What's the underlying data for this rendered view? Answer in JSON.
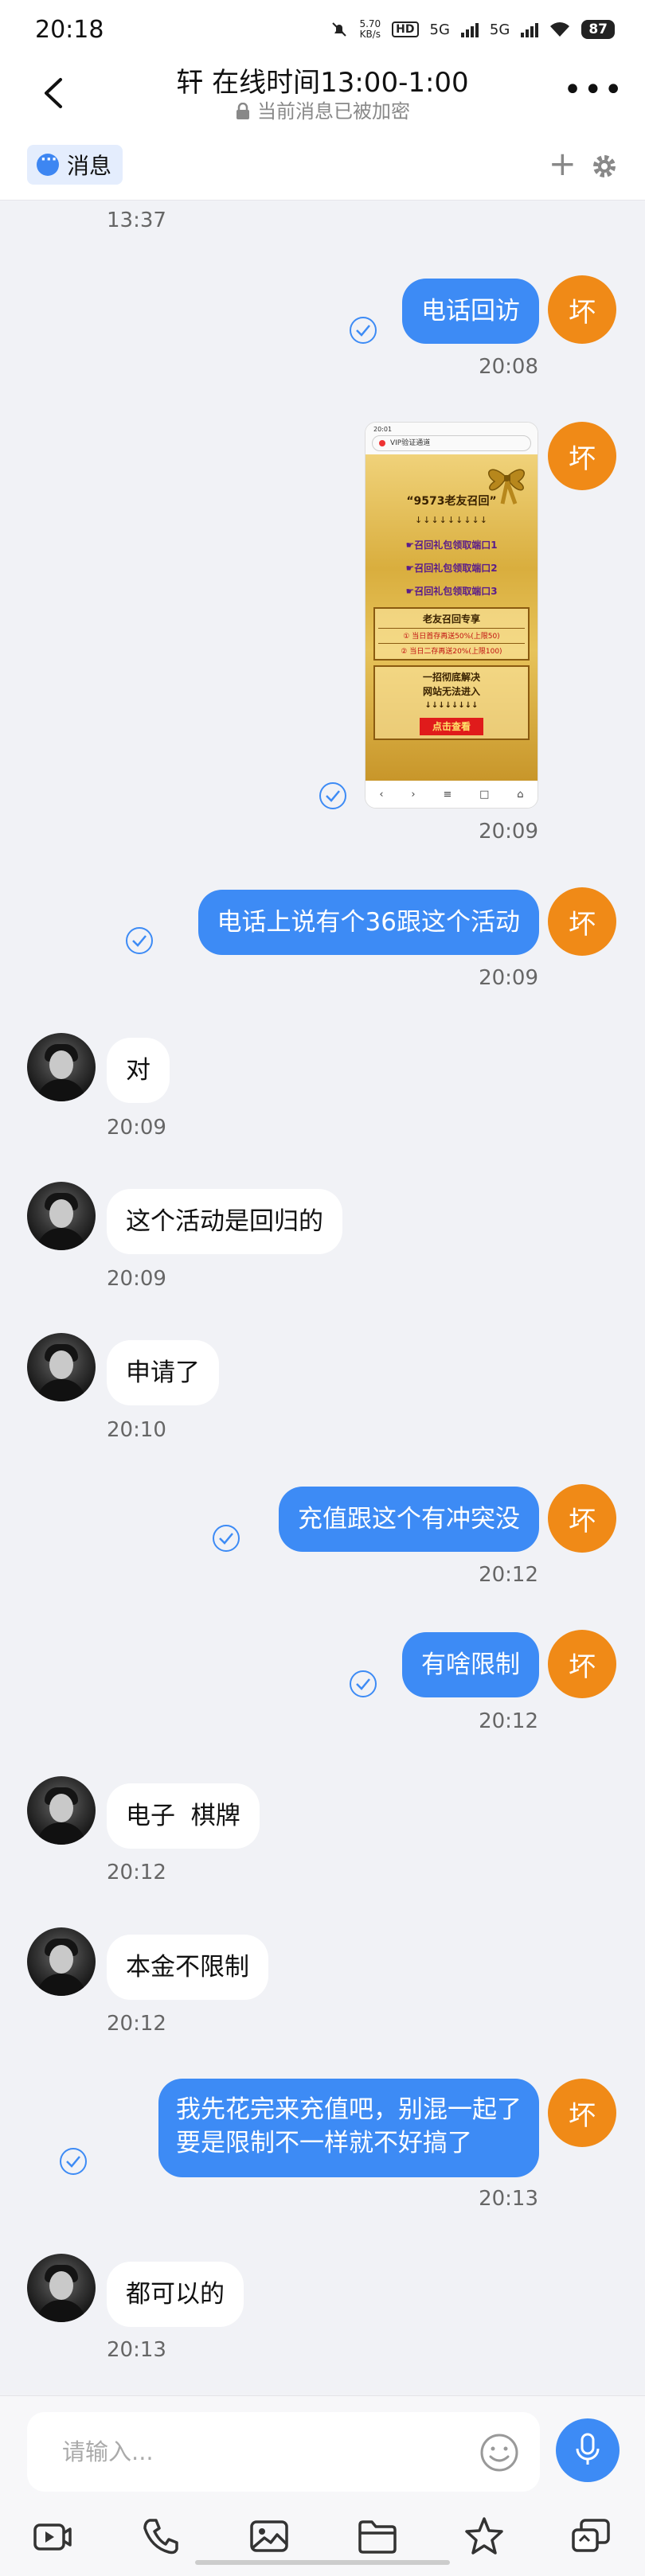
{
  "status_bar": {
    "time": "20:18",
    "net_speed_top": "5.70",
    "net_speed_bottom": "KB/s",
    "hd": "HD",
    "net1": "5G",
    "net2": "5G",
    "battery": "87"
  },
  "header": {
    "title": "轩  在线时间13:00-1:00",
    "subtitle": "当前消息已被加密"
  },
  "tab": {
    "label": "消息"
  },
  "messages": {
    "m0": {
      "time": "13:37"
    },
    "m1": {
      "text": "电话回访",
      "time": "20:08",
      "avatar": "坏"
    },
    "m2": {
      "time": "20:09",
      "avatar": "坏",
      "image": {
        "status_time": "20:01",
        "url": "VIP验证通道",
        "heading": "“9573老友召回”",
        "arrows": "↓↓↓↓↓↓↓↓↓",
        "link1": "☛召回礼包领取端口1",
        "link2": "☛召回礼包领取端口2",
        "link3": "☛召回礼包领取端口3",
        "panel_title": "老友召回专享",
        "panel_row1": "① 当日首存再送50%(上限50)",
        "panel_row2": "② 当日二存再送20%(上限100)",
        "fix_line1": "一招彻底解决",
        "fix_line2": "网站无法进入",
        "fix_arrows": "↓↓↓↓↓↓↓↓",
        "go": "点击查看"
      }
    },
    "m3": {
      "text": "电话上说有个36跟这个活动",
      "time": "20:09",
      "avatar": "坏"
    },
    "m4": {
      "text": "对",
      "time": "20:09"
    },
    "m5": {
      "text": "这个活动是回归的",
      "time": "20:09"
    },
    "m6": {
      "text": "申请了",
      "time": "20:10"
    },
    "m7": {
      "text": "充值跟这个有冲突没",
      "time": "20:12",
      "avatar": "坏"
    },
    "m8": {
      "text": "有啥限制",
      "time": "20:12",
      "avatar": "坏"
    },
    "m9": {
      "text": "电子  棋牌",
      "time": "20:12"
    },
    "m10": {
      "text": "本金不限制",
      "time": "20:12"
    },
    "m11": {
      "line1": "我先花完来充值吧，别混一起了",
      "line2": "要是限制不一样就不好搞了",
      "time": "20:13",
      "avatar": "坏"
    },
    "m12": {
      "text": "都可以的",
      "time": "20:13"
    }
  },
  "input": {
    "placeholder": "请输入..."
  },
  "colors": {
    "accent": "#3D8BF5",
    "my_avatar": "#F08A17",
    "background": "#F1F2F6"
  },
  "icons": [
    "back-icon",
    "lock-icon",
    "more-icon",
    "chat-icon",
    "plus-icon",
    "gear-icon",
    "read-check-icon",
    "emoji-icon",
    "microphone-icon",
    "video-icon",
    "phone-icon",
    "image-icon",
    "folder-icon",
    "star-icon",
    "reply-icon"
  ]
}
